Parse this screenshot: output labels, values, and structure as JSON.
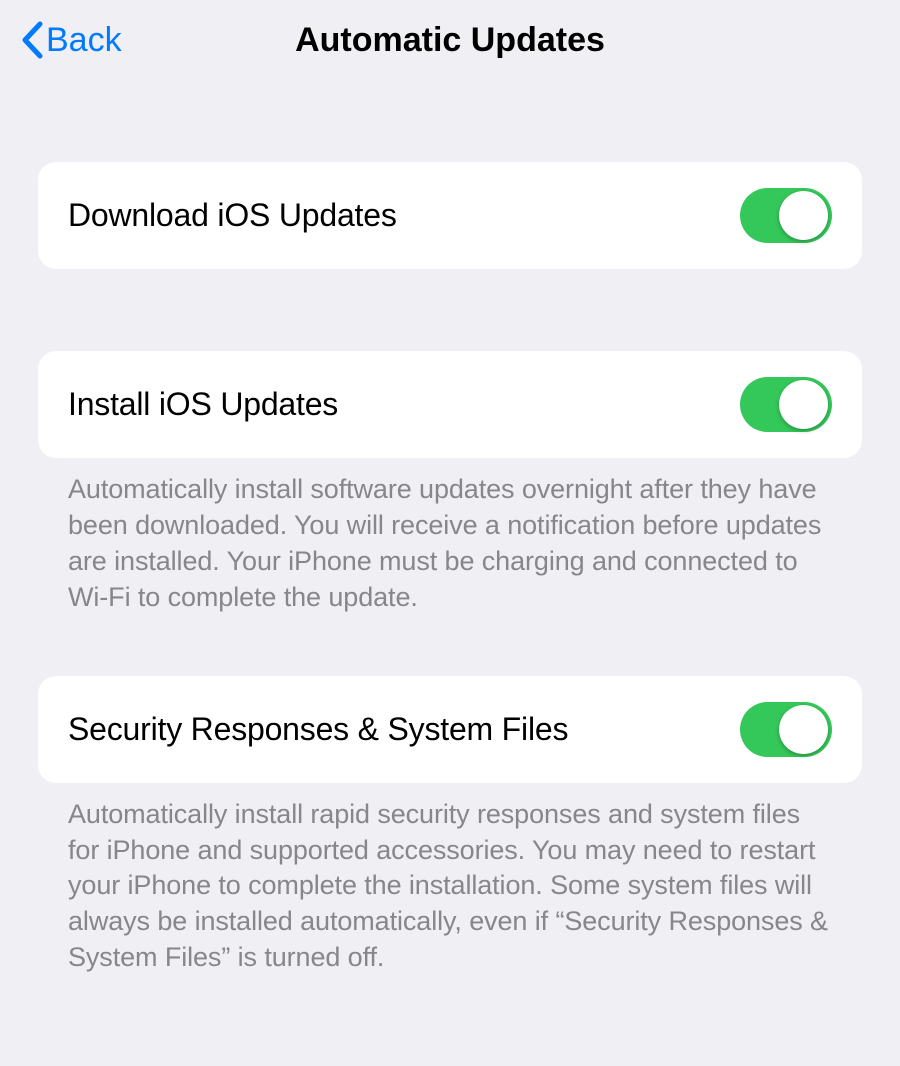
{
  "navbar": {
    "back_label": "Back",
    "title": "Automatic Updates"
  },
  "sections": [
    {
      "label": "Download iOS Updates",
      "toggle_on": true,
      "footer": null
    },
    {
      "label": "Install iOS Updates",
      "toggle_on": true,
      "footer": "Automatically install software updates overnight after they have been downloaded. You will receive a notification before updates are installed. Your iPhone must be charging and connected to Wi-Fi to complete the update."
    },
    {
      "label": "Security Responses & System Files",
      "toggle_on": true,
      "footer": "Automatically install rapid security responses and system files for iPhone and supported accessories. You may need to restart your iPhone to complete the installation. Some system files will always be installed automatically, even if “Security Responses & System Files” is turned off."
    }
  ]
}
